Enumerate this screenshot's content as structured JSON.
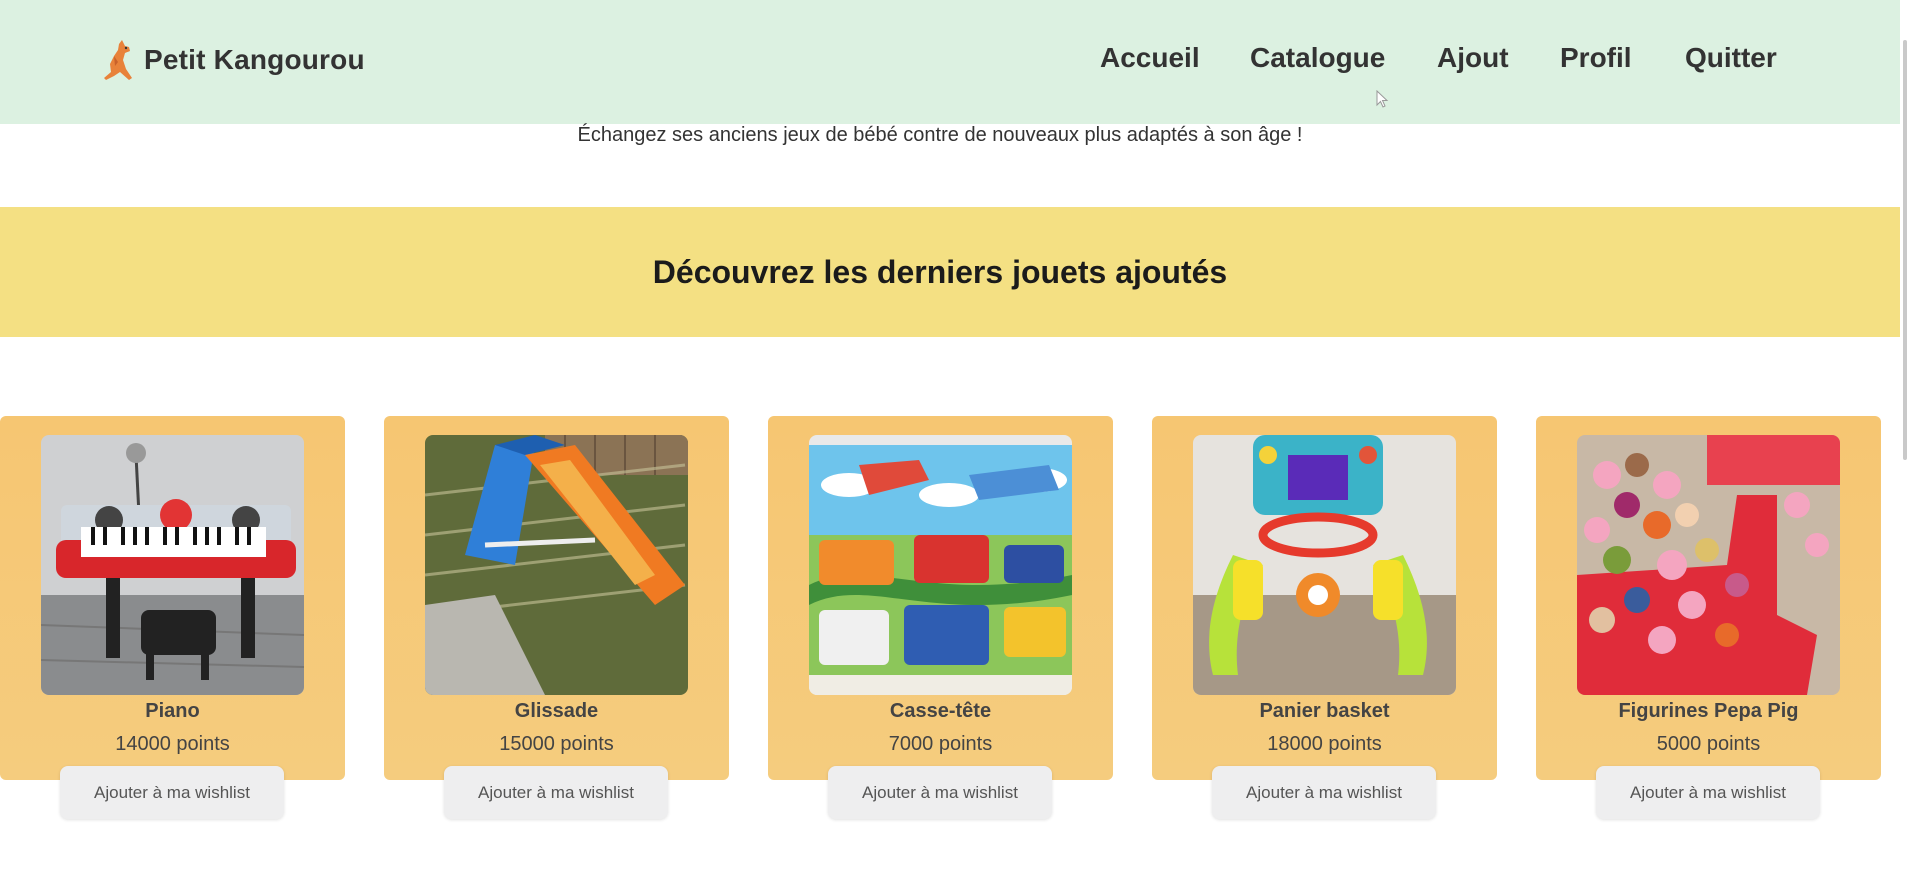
{
  "brand": {
    "name": "Petit Kangourou",
    "logo_icon": "kangaroo-icon"
  },
  "nav": {
    "links": [
      {
        "label": "Accueil"
      },
      {
        "label": "Catalogue"
      },
      {
        "label": "Ajout"
      },
      {
        "label": "Profil"
      },
      {
        "label": "Quitter"
      }
    ]
  },
  "tagline": "Échangez ses anciens jeux de bébé contre de nouveaux plus adaptés à son âge !",
  "banner": {
    "title": "Découvrez les derniers jouets ajoutés"
  },
  "products": [
    {
      "name": "Piano",
      "points": "14000 points",
      "button": "Ajouter à ma wishlist",
      "image": "toy-piano-image"
    },
    {
      "name": "Glissade",
      "points": "15000 points",
      "button": "Ajouter à ma wishlist",
      "image": "slide-image"
    },
    {
      "name": "Casse-tête",
      "points": "7000 points",
      "button": "Ajouter à ma wishlist",
      "image": "puzzle-image"
    },
    {
      "name": "Panier basket",
      "points": "18000 points",
      "button": "Ajouter à ma wishlist",
      "image": "basketball-hoop-image"
    },
    {
      "name": "Figurines Pepa Pig",
      "points": "5000 points",
      "button": "Ajouter à ma wishlist",
      "image": "figurines-image"
    }
  ],
  "colors": {
    "navbar_bg": "#dcf1e1",
    "banner_bg": "#f4e083",
    "card_bg": "#f6c672",
    "button_bg": "#eeeeef"
  }
}
